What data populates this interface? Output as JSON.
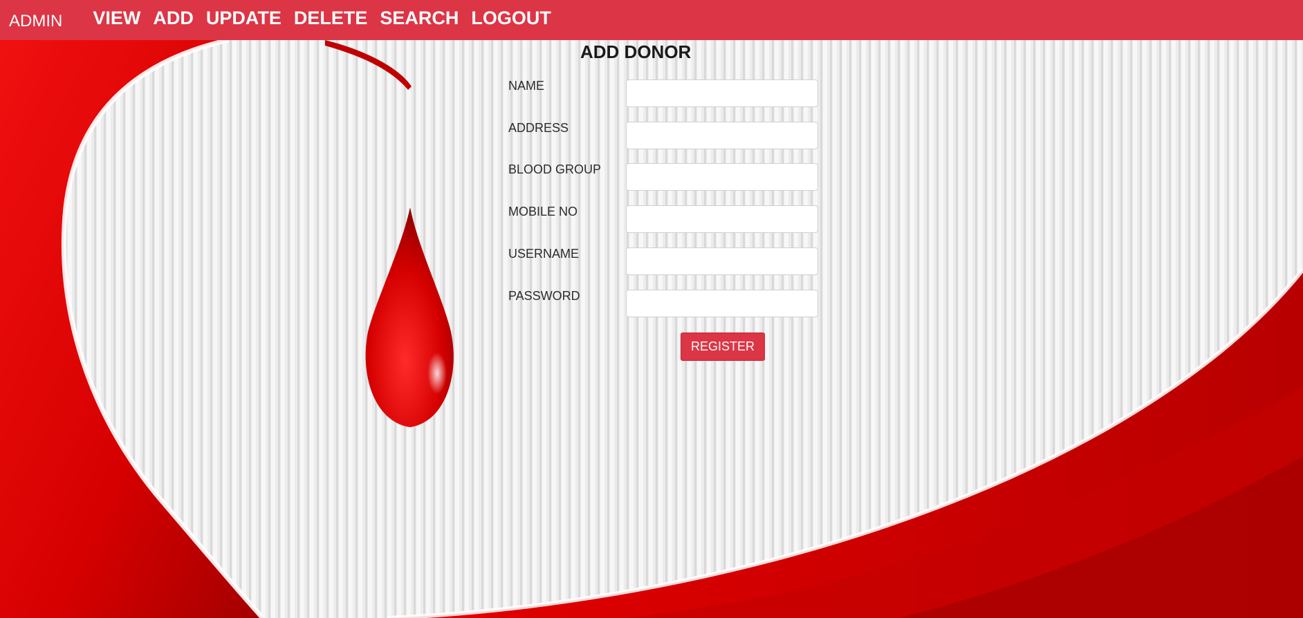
{
  "navbar": {
    "brand": "ADMIN",
    "links": [
      {
        "label": "VIEW"
      },
      {
        "label": "ADD"
      },
      {
        "label": "UPDATE"
      },
      {
        "label": "DELETE"
      },
      {
        "label": "SEARCH"
      },
      {
        "label": "LOGOUT"
      }
    ],
    "color": "#dc3545"
  },
  "form": {
    "title": "ADD DONOR",
    "fields": [
      {
        "label": "NAME",
        "value": "",
        "placeholder": ""
      },
      {
        "label": "ADDRESS",
        "value": "",
        "placeholder": ""
      },
      {
        "label": "BLOOD GROUP",
        "value": "",
        "placeholder": ""
      },
      {
        "label": "MOBILE NO",
        "value": "",
        "placeholder": ""
      },
      {
        "label": "USERNAME",
        "value": "",
        "placeholder": ""
      },
      {
        "label": "PASSWORD",
        "value": "",
        "placeholder": ""
      }
    ],
    "submit_label": "REGISTER"
  },
  "background": {
    "accent_red": "#e00000",
    "stripe_light": "#f2f2f2",
    "icon": "blood-drop-icon"
  }
}
